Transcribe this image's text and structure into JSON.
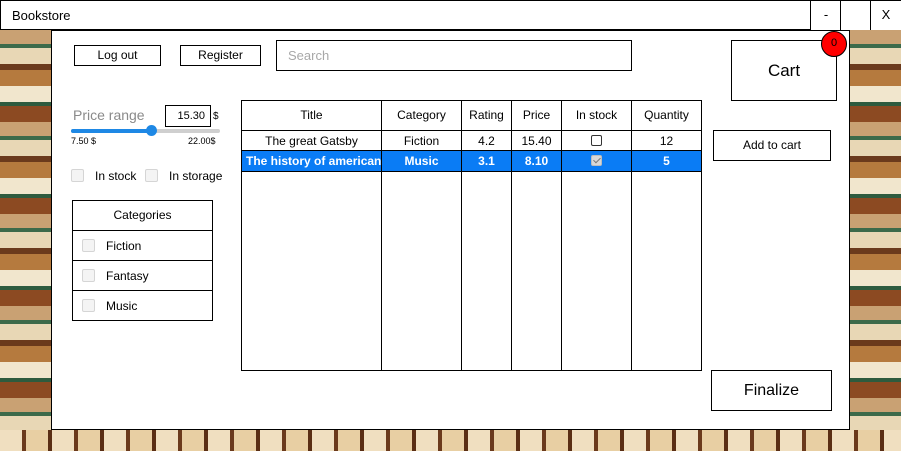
{
  "window": {
    "title": "Bookstore",
    "minimize_label": "-",
    "maximize_label": "",
    "close_label": "X"
  },
  "header": {
    "logout_label": "Log out",
    "register_label": "Register",
    "search_placeholder": "Search",
    "search_value": "",
    "cart_label": "Cart",
    "cart_count": "0"
  },
  "filters": {
    "price_range_label": "Price range",
    "price_value": "15.30",
    "price_unit": "$",
    "slider_min_label": "7.50 $",
    "slider_max_label": "22.00$",
    "slider_min": 7.5,
    "slider_max": 22.0,
    "slider_value": 15.3,
    "in_stock_label": "In stock",
    "in_storage_label": "In storage",
    "in_stock_checked": false,
    "in_storage_checked": false
  },
  "categories": {
    "header": "Categories",
    "items": [
      {
        "label": "Fiction",
        "checked": false
      },
      {
        "label": "Fantasy",
        "checked": false
      },
      {
        "label": "Music",
        "checked": false
      }
    ]
  },
  "table": {
    "columns": [
      "Title",
      "Category",
      "Rating",
      "Price",
      "In stock",
      "Quantity"
    ],
    "rows": [
      {
        "title": "The great Gatsby",
        "category": "Fiction",
        "rating": "4.2",
        "price": "15.40",
        "in_stock": false,
        "quantity": "12",
        "selected": false
      },
      {
        "title": "The history of american r",
        "category": "Music",
        "rating": "3.1",
        "price": "8.10",
        "in_stock": true,
        "quantity": "5",
        "selected": true
      }
    ]
  },
  "actions": {
    "add_to_cart_label": "Add to cart",
    "finalize_label": "Finalize"
  },
  "colors": {
    "selection": "#0a7cf5",
    "slider": "#1e88e5",
    "badge": "#ff0000"
  }
}
